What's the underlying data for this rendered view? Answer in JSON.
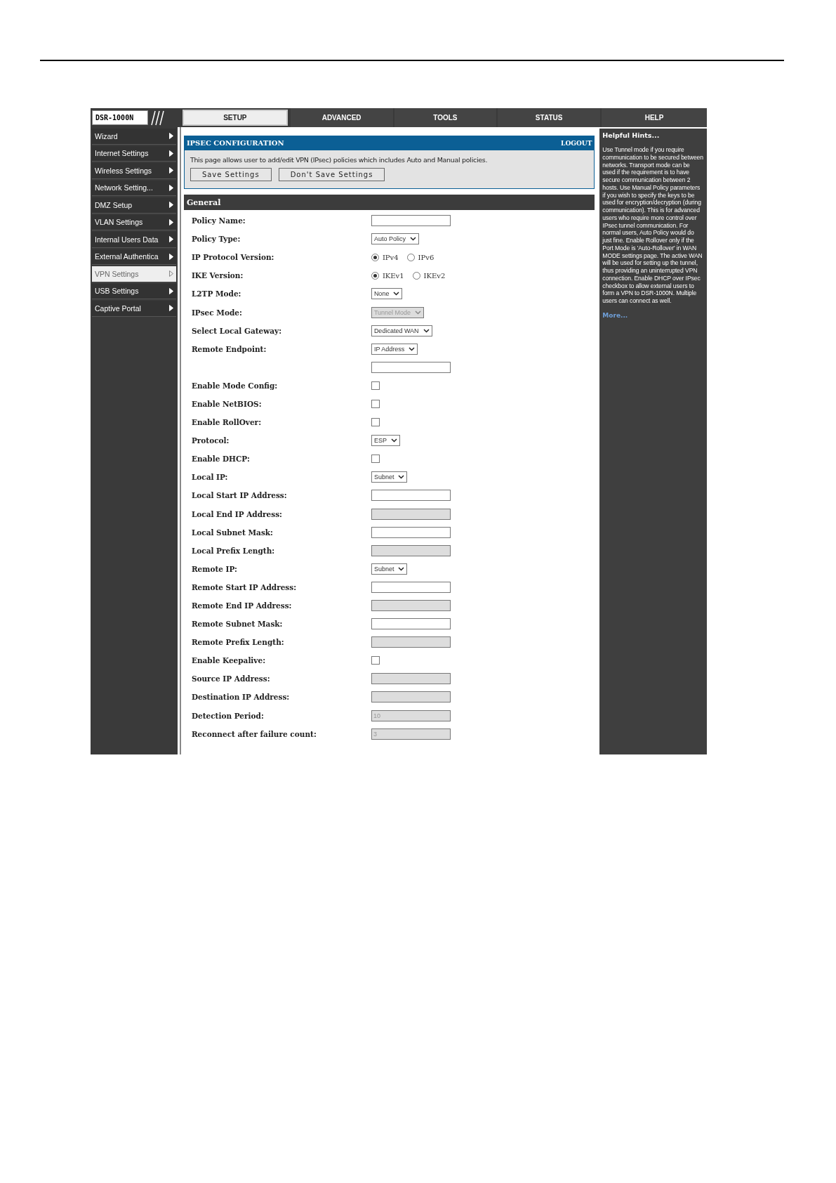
{
  "brand": {
    "model": "DSR-1000N"
  },
  "nav_tabs": [
    {
      "label": "SETUP",
      "selected": true
    },
    {
      "label": "ADVANCED",
      "selected": false
    },
    {
      "label": "TOOLS",
      "selected": false
    },
    {
      "label": "STATUS",
      "selected": false
    }
  ],
  "help_tab": {
    "label": "HELP"
  },
  "sidebar": {
    "items": [
      {
        "label": "Wizard",
        "selected": false
      },
      {
        "label": "Internet Settings",
        "selected": false
      },
      {
        "label": "Wireless Settings",
        "selected": false
      },
      {
        "label": "Network Setting...",
        "selected": false
      },
      {
        "label": "DMZ Setup",
        "selected": false
      },
      {
        "label": "VLAN Settings",
        "selected": false
      },
      {
        "label": "Internal Users Data",
        "selected": false
      },
      {
        "label": "External Authentica",
        "selected": false
      },
      {
        "label": "VPN Settings",
        "selected": true
      },
      {
        "label": "USB Settings",
        "selected": false
      },
      {
        "label": "Captive Portal",
        "selected": false
      }
    ]
  },
  "header": {
    "title": "IPSEC CONFIGURATION",
    "logout": "LOGOUT",
    "description": "This page allows user to add/edit VPN (IPsec) policies which includes Auto and Manual policies.",
    "buttons": [
      "Save Settings",
      "Don't Save Settings"
    ]
  },
  "section": {
    "title": "General"
  },
  "rows": [
    {
      "kind": "text",
      "label": "Policy Name:",
      "disabled": false
    },
    {
      "kind": "select",
      "label": "Policy Type:",
      "value": "Auto Policy",
      "disabled": false
    },
    {
      "kind": "radio",
      "label": "IP Protocol Version:",
      "options": [
        {
          "label": "IPv4",
          "selected": true
        },
        {
          "label": "IPv6",
          "selected": false
        }
      ]
    },
    {
      "kind": "radio",
      "label": "IKE Version:",
      "options": [
        {
          "label": "IKEv1",
          "selected": true
        },
        {
          "label": "IKEv2",
          "selected": false
        }
      ]
    },
    {
      "kind": "select",
      "label": "L2TP Mode:",
      "value": "None",
      "disabled": false
    },
    {
      "kind": "select",
      "label": "IPsec Mode:",
      "value": "Tunnel Mode",
      "disabled": true
    },
    {
      "kind": "select",
      "label": "Select Local Gateway:",
      "value": "Dedicated WAN",
      "disabled": false
    },
    {
      "kind": "select",
      "label": "Remote Endpoint:",
      "value": "IP Address",
      "disabled": false
    },
    {
      "kind": "text",
      "disabled": false
    },
    {
      "kind": "checkbox",
      "label": "Enable Mode Config:",
      "checked": false
    },
    {
      "kind": "checkbox",
      "label": "Enable NetBIOS:",
      "checked": false
    },
    {
      "kind": "checkbox",
      "label": "Enable RollOver:",
      "checked": false
    },
    {
      "kind": "select",
      "label": "Protocol:",
      "value": "ESP",
      "disabled": false
    },
    {
      "kind": "checkbox",
      "label": "Enable DHCP:",
      "checked": false
    },
    {
      "kind": "select",
      "label": "Local IP:",
      "value": "Subnet",
      "disabled": false
    },
    {
      "kind": "text",
      "label": "Local Start IP Address:",
      "disabled": false
    },
    {
      "kind": "text",
      "label": "Local End IP Address:",
      "disabled": true
    },
    {
      "kind": "text",
      "label": "Local Subnet Mask:",
      "disabled": false
    },
    {
      "kind": "text",
      "label": "Local Prefix Length:",
      "disabled": true
    },
    {
      "kind": "select",
      "label": "Remote IP:",
      "value": "Subnet",
      "disabled": false
    },
    {
      "kind": "text",
      "label": "Remote Start IP Address:",
      "disabled": false
    },
    {
      "kind": "text",
      "label": "Remote End IP Address:",
      "disabled": true
    },
    {
      "kind": "text",
      "label": "Remote Subnet Mask:",
      "disabled": false
    },
    {
      "kind": "text",
      "label": "Remote Prefix Length:",
      "disabled": true
    },
    {
      "kind": "checkbox",
      "label": "Enable Keepalive:",
      "checked": false
    },
    {
      "kind": "text",
      "label": "Source IP Address:",
      "disabled": true
    },
    {
      "kind": "text",
      "label": "Destination IP Address:",
      "disabled": true
    },
    {
      "kind": "text",
      "label": "Detection Period:",
      "value": "10",
      "disabled": true
    },
    {
      "kind": "text",
      "label": "Reconnect after failure count:",
      "value": "3",
      "disabled": true
    }
  ],
  "help": {
    "title": "Helpful Hints...",
    "text": "Use Tunnel mode if you require communication to be secured between networks. Transport mode can be used if the requirement is to have secure communication between 2 hosts. Use Manual Policy parameters if you wish to specify the keys to be used for encryption/decryption (during communication). This is for advanced users who require more control over IPsec tunnel communication. For normal users, Auto Policy would do just fine. Enable Rollover only if the Port Mode is 'Auto-Rollover' in WAN MODE settings page. The active WAN will be used for setting up the tunnel, thus providing an uninterrupted VPN connection. Enable DHCP over IPsec checkbox to allow external users to form a VPN to DSR-1000N. Multiple users can connect as well.",
    "more": "More..."
  }
}
